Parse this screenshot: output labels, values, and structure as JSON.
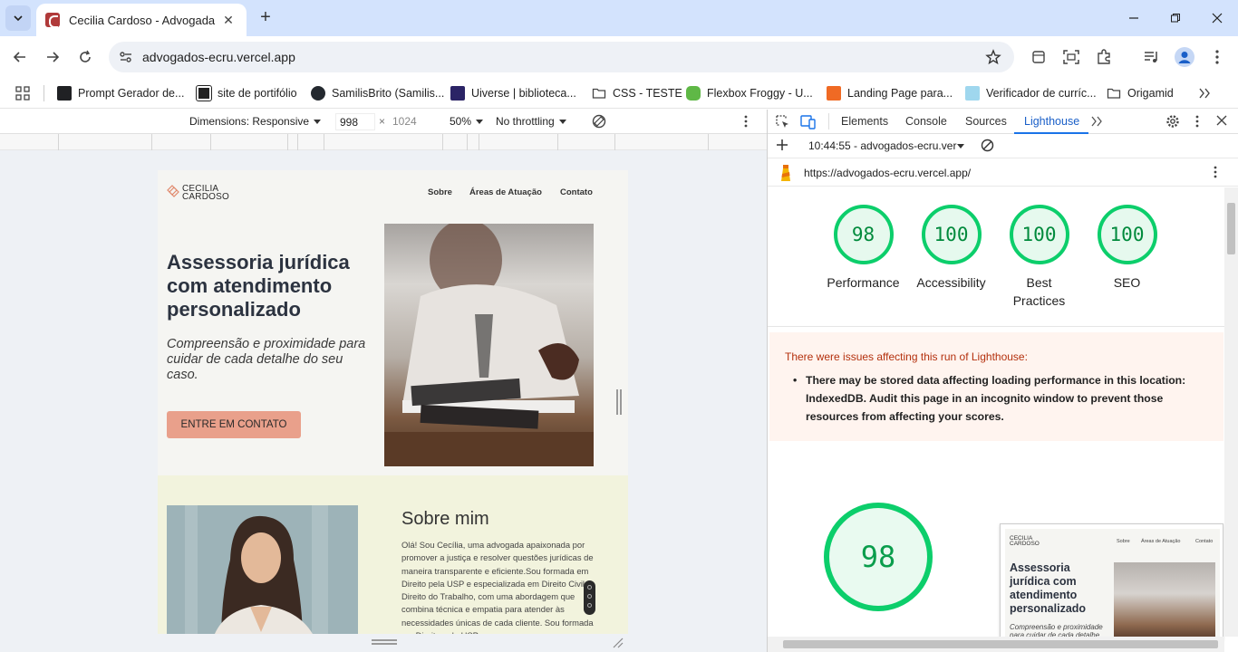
{
  "browser": {
    "tab_title": "Cecilia Cardoso - Advogada",
    "url": "advogados-ecru.vercel.app",
    "bookmarks": [
      {
        "label": "Prompt Gerador de..."
      },
      {
        "label": "site de portifólio"
      },
      {
        "label": "SamilisBrito (Samilis..."
      },
      {
        "label": "Uiverse | biblioteca..."
      },
      {
        "label": "CSS - TESTE"
      },
      {
        "label": "Flexbox Froggy - U..."
      },
      {
        "label": "Landing Page para..."
      },
      {
        "label": "Verificador de curríc..."
      },
      {
        "label": "Origamid"
      }
    ]
  },
  "device_toolbar": {
    "dimensions_label": "Dimensions: Responsive",
    "width_value": "998",
    "times": "×",
    "height_value": "1024",
    "zoom": "50%",
    "throttling": "No throttling"
  },
  "site": {
    "logo_line1": "CECILIA",
    "logo_line2": "CARDOSO",
    "nav": [
      "Sobre",
      "Áreas de Atuação",
      "Contato"
    ],
    "hero_title": "Assessoria jurídica com atendimento personalizado",
    "hero_subtitle": "Compreensão e proximidade para cuidar de cada detalhe do seu caso.",
    "cta": "ENTRE EM CONTATO",
    "about_title": "Sobre mim",
    "about_text": "Olá! Sou Cecília, uma advogada apaixonada por promover a justiça e resolver questões jurídicas de maneira transparente e eficiente.Sou formada em Direito pela USP e especializada em Direito Civil e Direito do Trabalho, com uma abordagem que combina técnica e empatia para atender às necessidades únicas de cada cliente. Sou formada em Direito pela USP e"
  },
  "devtools": {
    "tabs": [
      "Elements",
      "Console",
      "Sources",
      "Lighthouse"
    ],
    "active_tab": "Lighthouse",
    "report_selector": "10:44:55 - advogados-ecru.ver",
    "report_url": "https://advogados-ecru.vercel.app/",
    "scores": [
      {
        "value": "98",
        "label": "Performance"
      },
      {
        "value": "100",
        "label": "Accessibility"
      },
      {
        "value": "100",
        "label": "Best Practices"
      },
      {
        "value": "100",
        "label": "SEO"
      }
    ],
    "warning_title": "There were issues affecting this run of Lighthouse:",
    "warning_item": "There may be stored data affecting loading performance in this location: IndexedDB. Audit this page in an incognito window to prevent those resources from affecting your scores.",
    "big_score": "98",
    "score_color": "#0cce6b"
  }
}
